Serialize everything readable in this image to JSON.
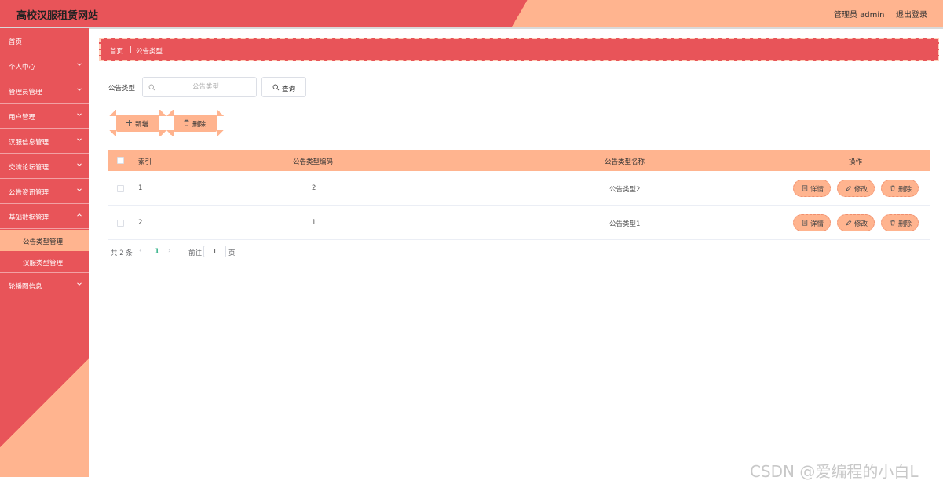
{
  "header": {
    "app_title": "高校汉服租赁网站",
    "admin_label": "管理员 admin",
    "logout_label": "退出登录"
  },
  "sidebar": {
    "items": [
      {
        "label": "首页",
        "expandable": false
      },
      {
        "label": "个人中心",
        "expandable": true
      },
      {
        "label": "管理员管理",
        "expandable": true
      },
      {
        "label": "用户管理",
        "expandable": true
      },
      {
        "label": "汉服信息管理",
        "expandable": true
      },
      {
        "label": "交流论坛管理",
        "expandable": true
      },
      {
        "label": "公告资讯管理",
        "expandable": true
      },
      {
        "label": "基础数据管理",
        "expandable": true,
        "expanded": true
      },
      {
        "label": "轮播图信息",
        "expandable": true
      }
    ],
    "sub_items": [
      {
        "label": "公告类型管理",
        "active": true
      },
      {
        "label": "汉服类型管理",
        "active": false
      }
    ]
  },
  "breadcrumb": {
    "home": "首页",
    "separator": "|",
    "current": "公告类型"
  },
  "search": {
    "label": "公告类型",
    "placeholder": "公告类型",
    "value": "",
    "query_label": "查询"
  },
  "actions": {
    "add_label": "新增",
    "delete_label": "删除"
  },
  "table": {
    "columns": [
      "索引",
      "公告类型编码",
      "公告类型名称",
      "操作"
    ],
    "rows": [
      {
        "index": "1",
        "code": "2",
        "name": "公告类型2"
      },
      {
        "index": "2",
        "code": "1",
        "name": "公告类型1"
      }
    ],
    "row_actions": {
      "detail": "详情",
      "edit": "修改",
      "delete": "删除"
    }
  },
  "pagination": {
    "total": "共 2 条",
    "current_page": "1",
    "goto_label": "前往",
    "goto_value": "1",
    "page_suffix": "页"
  },
  "watermark": "CSDN @爱编程的小白L",
  "colors": {
    "primary": "#e85459",
    "accent": "#ffb48f",
    "page_active": "#38b48b"
  }
}
